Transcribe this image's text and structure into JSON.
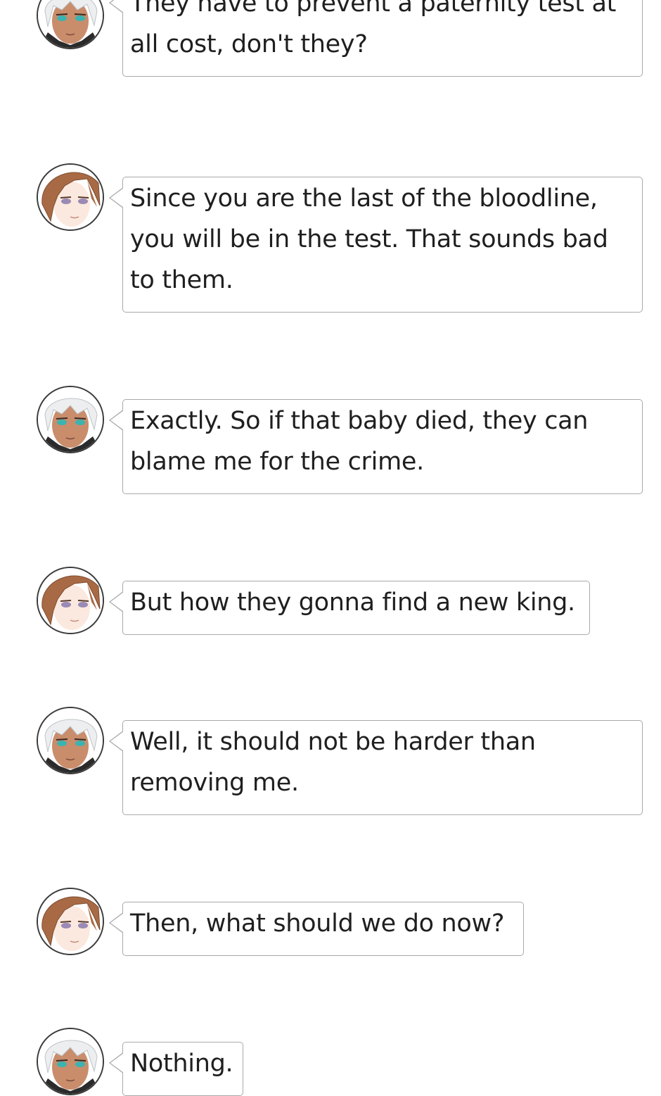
{
  "messages": [
    {
      "speaker": "white-haired-character",
      "text": "They have to prevent a paternity test at all cost, don't they?"
    },
    {
      "speaker": "brown-haired-character",
      "text": "Since you are the last of the bloodline, you will be in the test. That sounds bad to them."
    },
    {
      "speaker": "white-haired-character",
      "text": "Exactly. So if that baby died, they can blame me for the crime."
    },
    {
      "speaker": "brown-haired-character",
      "text": "But how they gonna find a new king."
    },
    {
      "speaker": "white-haired-character",
      "text": "Well, it should not be harder than removing me."
    },
    {
      "speaker": "brown-haired-character",
      "text": "Then, what should we do now?"
    },
    {
      "speaker": "white-haired-character",
      "text": "Nothing."
    }
  ],
  "colors": {
    "bubble_border": "#a9a9a9",
    "text": "#1f1f1f",
    "avatar_border": "#3a3a3a",
    "white_hair": "#eceef0",
    "brown_hair": "#a86a44",
    "skin_tan": "#c98d6c",
    "skin_light": "#fbe9df",
    "eye_teal": "#3bb3b0",
    "eye_lilac": "#9a8ab5"
  }
}
